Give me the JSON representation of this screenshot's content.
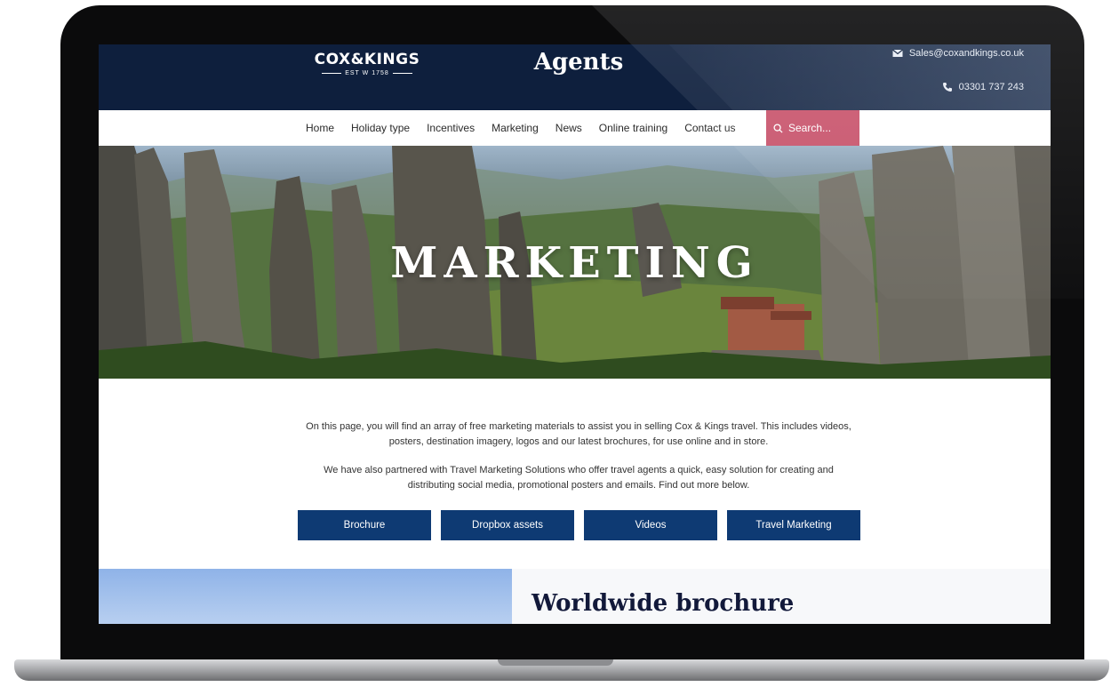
{
  "brand": {
    "logo_main": "COX&KINGS",
    "logo_sub": "EST W 1758",
    "section_title": "Agents"
  },
  "contact": {
    "email": "Sales@coxandkings.co.uk",
    "phone": "03301 737 243",
    "email_icon": "envelope-icon",
    "phone_icon": "phone-icon"
  },
  "nav": {
    "items": [
      {
        "label": "Home"
      },
      {
        "label": "Holiday type"
      },
      {
        "label": "Incentives"
      },
      {
        "label": "Marketing"
      },
      {
        "label": "News"
      },
      {
        "label": "Online training"
      },
      {
        "label": "Contact us"
      }
    ],
    "search_placeholder": "Search...",
    "search_icon": "search-icon",
    "search_color": "#c9566e"
  },
  "hero": {
    "title": "MARKETING"
  },
  "intro": {
    "paragraph1": "On this page, you will find an array of free marketing materials to assist you in selling Cox & Kings travel. This includes videos, posters, destination imagery, logos and our latest brochures, for use online and in store.",
    "paragraph2": "We have also partnered with Travel Marketing Solutions who offer travel agents a quick, easy solution for creating and distributing social media, promotional posters and emails. Find out more below."
  },
  "buttons": [
    {
      "label": "Brochure"
    },
    {
      "label": "Dropbox assets"
    },
    {
      "label": "Videos"
    },
    {
      "label": "Travel Marketing"
    }
  ],
  "brochure": {
    "title": "Worldwide brochure"
  },
  "colors": {
    "header_navy": "#0e1f3d",
    "button_blue": "#0e3a73"
  }
}
